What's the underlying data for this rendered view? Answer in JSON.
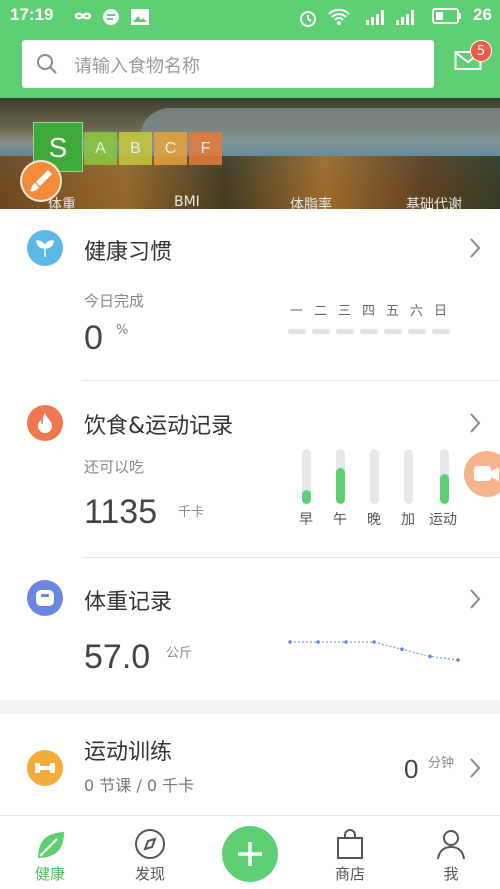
{
  "status": {
    "time": "17:19",
    "battery": "26"
  },
  "search": {
    "placeholder": "请输入食物名称"
  },
  "mail": {
    "badge": "5"
  },
  "banner": {
    "grades": [
      "S",
      "A",
      "B",
      "C",
      "F"
    ],
    "grade_colors": [
      "#3faa3a",
      "#8cc83c",
      "#c8c83a",
      "#e8a23a",
      "#e87a3a"
    ],
    "metrics": [
      "体重",
      "BMI",
      "体脂率",
      "基础代谢"
    ]
  },
  "habits": {
    "title": "健康习惯",
    "sub": "今日完成",
    "value": "0",
    "unit": "%",
    "weekdays": [
      "一",
      "二",
      "三",
      "四",
      "五",
      "六",
      "日"
    ]
  },
  "diet": {
    "title": "饮食&运动记录",
    "sub": "还可以吃",
    "value": "1135",
    "unit": "千卡",
    "meals": [
      {
        "label": "早",
        "level": 0.25
      },
      {
        "label": "午",
        "level": 0.65
      },
      {
        "label": "晚",
        "level": 0
      },
      {
        "label": "加",
        "level": 0
      },
      {
        "label": "运动",
        "level": 0.55
      }
    ]
  },
  "weight": {
    "title": "体重记录",
    "value": "57.0",
    "unit": "公斤",
    "trend": [
      57.2,
      57.2,
      57.2,
      57.2,
      57.1,
      57.0,
      56.95
    ]
  },
  "training": {
    "title": "运动训练",
    "sub": "0 节课 / 0 千卡",
    "value": "0",
    "unit": "分钟"
  },
  "nav": {
    "items": [
      "健康",
      "发现",
      "商店",
      "我"
    ],
    "accent": "#5fcf73"
  }
}
